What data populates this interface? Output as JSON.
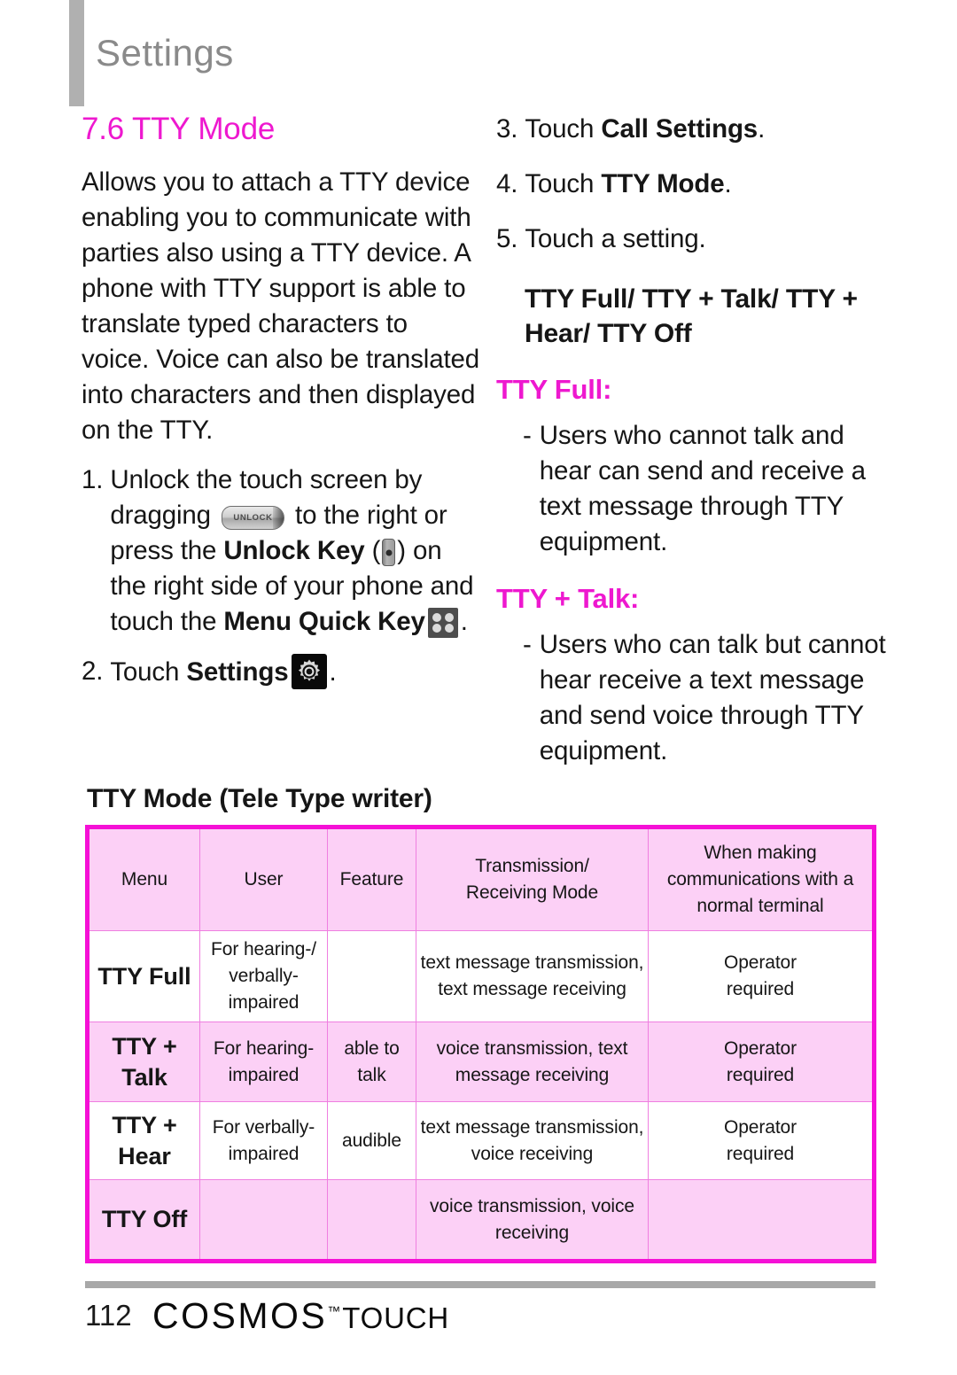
{
  "header": {
    "title": "Settings"
  },
  "left": {
    "section_number_title": "7.6 TTY Mode",
    "intro": "Allows you to attach a TTY device enabling you to communicate with parties also using a TTY device. A phone with TTY support is able to translate typed characters to voice. Voice can also be translated into characters and then displayed on the TTY.",
    "step1": {
      "num": "1.",
      "part_a": "Unlock the touch screen by dragging",
      "unlock_slider_label": "UNLOCK",
      "part_b": "to the right or press the",
      "bold_unlock_key": "Unlock Key",
      "paren_open": "(",
      "paren_close": ")",
      "part_c": "on the right side of your phone and touch the",
      "bold_menu_quick_key": "Menu Quick Key",
      "part_d": "."
    },
    "step2": {
      "num": "2.",
      "part_a": "Touch",
      "bold_settings": "Settings",
      "part_b": "."
    }
  },
  "right": {
    "step3": {
      "num": "3.",
      "part_a": "Touch",
      "bold": "Call Settings",
      "part_b": "."
    },
    "step4": {
      "num": "4.",
      "part_a": "Touch",
      "bold": "TTY Mode",
      "part_b": "."
    },
    "step5": {
      "num": "5.",
      "text": "Touch a setting."
    },
    "mode_heading": "TTY Full/ TTY + Talk/ TTY + Hear/ TTY Off",
    "tty_full_label": "TTY Full:",
    "tty_full_bullet_dash": "-",
    "tty_full_bullet": "Users who cannot  talk and hear can send and receive a text message through TTY equipment.",
    "tty_talk_label": "TTY + Talk:",
    "tty_talk_bullet_dash": "-",
    "tty_talk_bullet": "Users who can talk but cannot hear receive a text message and send voice through TTY equipment."
  },
  "table": {
    "heading": "TTY Mode (Tele Type writer)",
    "columns": [
      "Menu",
      "User",
      "Feature",
      "Transmission/\nReceiving Mode",
      "When making\ncommunications with a\nnormal terminal"
    ],
    "col_transmission_l1": "Transmission/",
    "col_transmission_l2": "Receiving Mode",
    "col_when_l1": "When making",
    "col_when_l2": "communications with a",
    "col_when_l3": "normal terminal",
    "rows": [
      {
        "menu": "TTY Full",
        "user_l1": "For hearing-/",
        "user_l2": "verbally-",
        "user_l3": "impaired",
        "feature": "",
        "mode_l1": "text message transmission,",
        "mode_l2": "text message receiving",
        "normal_l1": "Operator",
        "normal_l2": "required",
        "shade": "white"
      },
      {
        "menu_l1": "TTY +",
        "menu_l2": "Talk",
        "user_l1": "For hearing-",
        "user_l2": "impaired",
        "feature_l1": "able to",
        "feature_l2": "talk",
        "mode_l1": "voice transmission, text",
        "mode_l2": "message receiving",
        "normal_l1": "Operator",
        "normal_l2": "required",
        "shade": "pink"
      },
      {
        "menu_l1": "TTY +",
        "menu_l2": "Hear",
        "user_l1": "For verbally-",
        "user_l2": "impaired",
        "feature": "audible",
        "mode_l1": "text message transmission,",
        "mode_l2": "voice receiving",
        "normal_l1": "Operator",
        "normal_l2": "required",
        "shade": "white"
      },
      {
        "menu": "TTY Off",
        "user": "",
        "feature": "",
        "mode_l1": "voice transmission, voice",
        "mode_l2": "receiving",
        "normal": "",
        "shade": "pink"
      }
    ]
  },
  "footer": {
    "page_number": "112",
    "brand": "COSMOS",
    "trademark": "™",
    "product": "TOUCH"
  },
  "colors": {
    "magenta": "#ee18cf",
    "table_border": "#f510d6",
    "table_grid": "#ef7fe0",
    "table_pink_fill": "#fcd0f6",
    "header_gray": "#8a8a8a",
    "bar_gray": "#b0b0b0"
  }
}
